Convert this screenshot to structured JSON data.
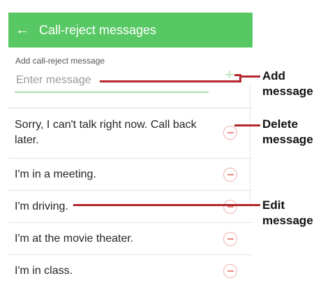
{
  "header": {
    "title": "Call-reject messages",
    "back_icon": "arrow-left-icon"
  },
  "add_section": {
    "label": "Add call-reject message",
    "placeholder": "Enter message",
    "add_icon": "plus-icon"
  },
  "messages": [
    "Sorry, I can't talk right now. Call back later.",
    "I'm in a meeting.",
    "I'm driving.",
    "I'm at the movie theater.",
    "I'm in class."
  ],
  "callouts": {
    "add": [
      "Add",
      "message"
    ],
    "delete": [
      "Delete",
      "message"
    ],
    "edit": [
      "Edit",
      "message"
    ]
  },
  "colors": {
    "accent_green": "#57c864",
    "delete_red": "#ef8686",
    "callout_line": "#b3272d"
  }
}
